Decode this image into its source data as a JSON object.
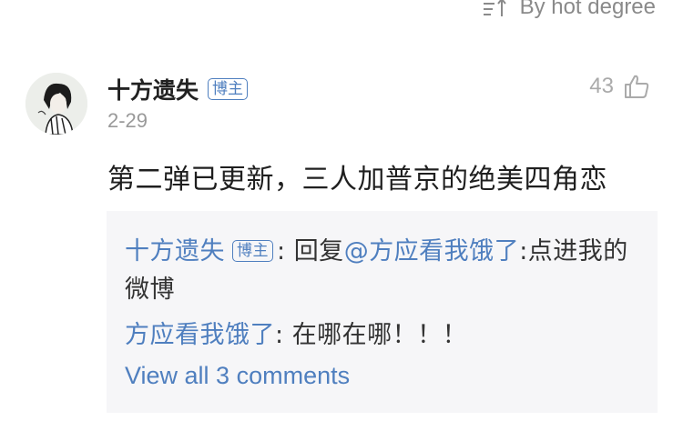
{
  "sort": {
    "label": "By hot degree",
    "icon": "sort-icon"
  },
  "comment": {
    "username": "十方遗失",
    "badge": "博主",
    "date": "2-29",
    "likes": "43",
    "text": "第二弹已更新，三人加普京的绝美四角恋"
  },
  "replies": [
    {
      "author": "十方遗失",
      "badge": "博主",
      "separator": ": ",
      "prefix": "回复",
      "mention": "@方应看我饿了",
      "text": ":点进我的微博"
    },
    {
      "author": "方应看我饿了",
      "separator": ": ",
      "text": "在哪在哪！！！"
    }
  ],
  "view_all_label": "View all 3 comments",
  "colors": {
    "link": "#4f7fbf",
    "muted": "#999999",
    "reply_bg": "#f6f6f8"
  }
}
